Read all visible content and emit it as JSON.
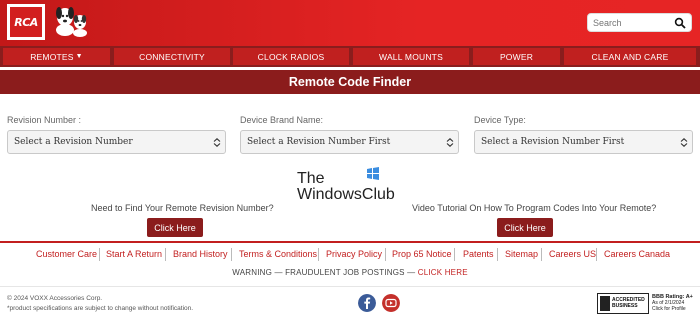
{
  "header": {
    "logo_text": "RCA",
    "search_placeholder": "Search",
    "brand_color": "#e52424"
  },
  "nav": {
    "items": [
      {
        "label": "REMOTES",
        "has_dropdown": true
      },
      {
        "label": "CONNECTIVITY"
      },
      {
        "label": "CLOCK RADIOS"
      },
      {
        "label": "WALL MOUNTS"
      },
      {
        "label": "POWER"
      },
      {
        "label": "CLEAN AND CARE"
      }
    ]
  },
  "title": "Remote Code Finder",
  "form": {
    "revision": {
      "label": "Revision Number :",
      "selected": "Select a Revision Number"
    },
    "brand": {
      "label": "Device Brand Name:",
      "selected": "Select a Revision Number First"
    },
    "type": {
      "label": "Device Type:",
      "selected": "Select a Revision Number First"
    }
  },
  "watermark": {
    "line1": "The",
    "line2": "WindowsClub"
  },
  "help": {
    "left_text": "Need to Find Your Remote Revision Number?",
    "left_button": "Click Here",
    "right_text": "Video Tutorial On How To Program Codes Into Your Remote?",
    "right_button": "Click Here"
  },
  "footer_links": [
    "Customer Care",
    "Start A Return",
    "Brand History",
    "Terms & Conditions",
    "Privacy Policy",
    "Prop 65 Notice",
    "Patents",
    "Sitemap",
    "Careers US",
    "Careers Canada"
  ],
  "warning": {
    "text": "WARNING — FRAUDULENT JOB POSTINGS —",
    "link": "CLICK HERE"
  },
  "footer": {
    "copyright": "© 2024 VOXX Accessories Corp.",
    "disclaimer": "*product specifications are subject to change without notification.",
    "bbb_badge_line1": "ACCREDITED",
    "bbb_badge_line2": "BUSINESS",
    "bbb_rating": "BBB Rating: A+",
    "bbb_date": "As of 2/1/2024",
    "bbb_profile": "Click for Profile"
  },
  "icons": {
    "search": "search-icon",
    "facebook": "facebook-icon",
    "youtube": "youtube-icon"
  }
}
